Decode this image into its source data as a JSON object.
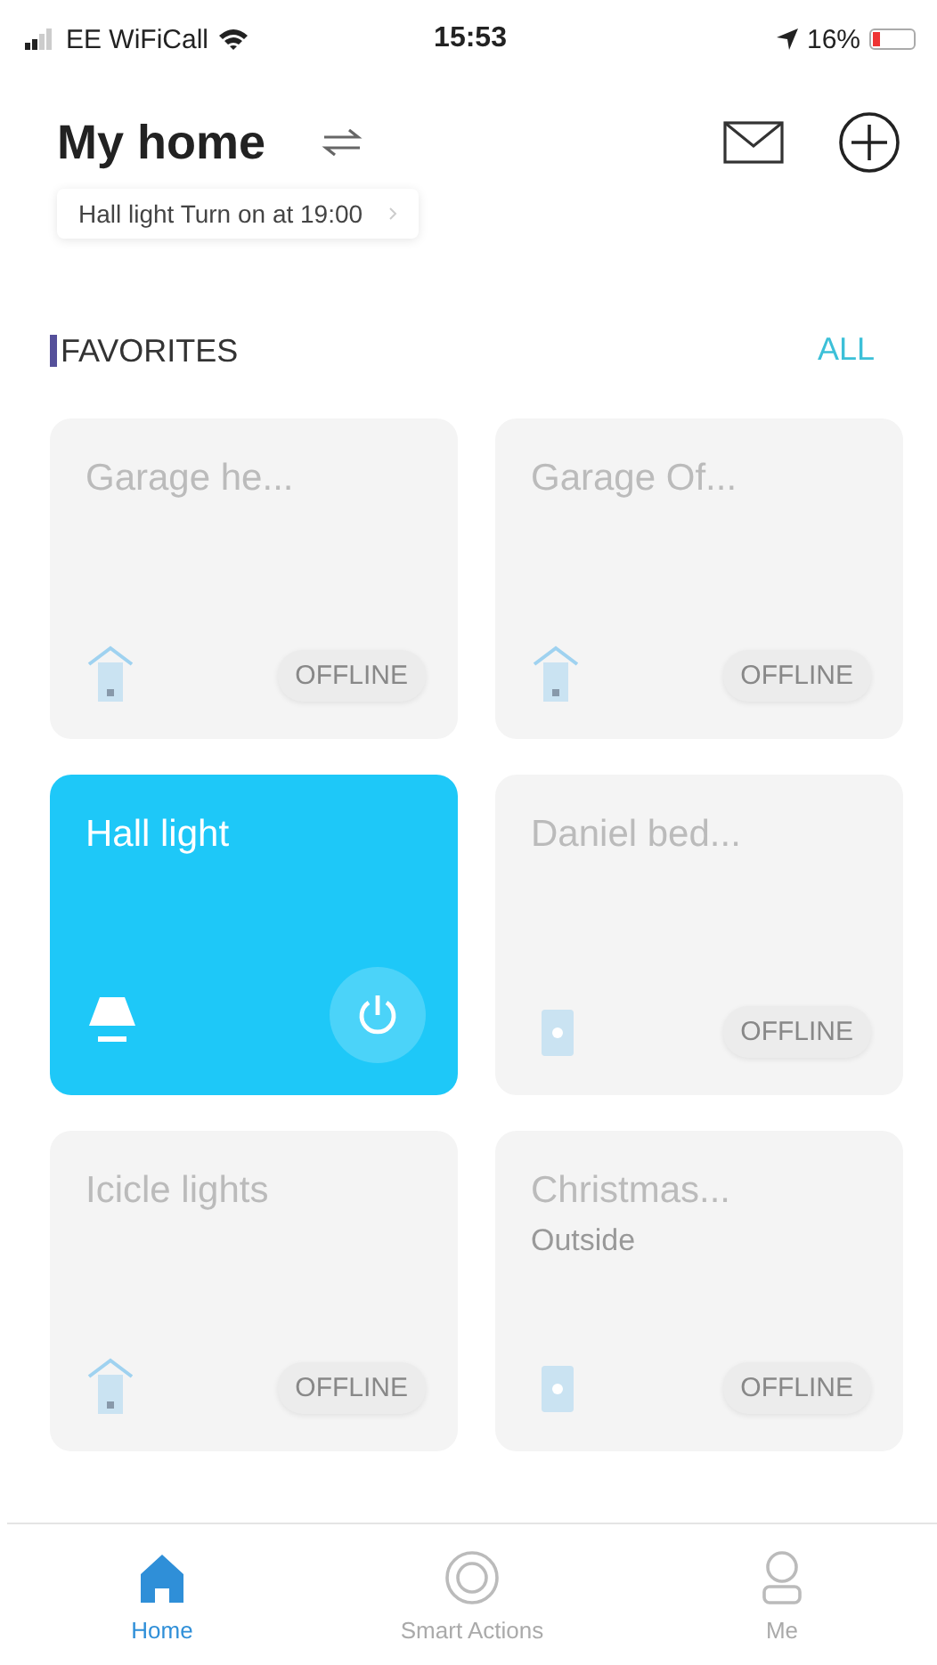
{
  "status_bar": {
    "carrier": "EE WiFiCall",
    "time": "15:53",
    "battery": "16%"
  },
  "header": {
    "title": "My home",
    "notice": "Hall light Turn on at 19:00"
  },
  "favorites": {
    "title": "FAVORITES",
    "link": "ALL"
  },
  "devices": [
    {
      "name": "Garage he...",
      "kind": "bulb",
      "online": false,
      "status": "OFFLINE"
    },
    {
      "name": "Garage Of...",
      "kind": "bulb",
      "online": false,
      "status": "OFFLINE"
    },
    {
      "name": "Hall light",
      "kind": "lamp",
      "online": true
    },
    {
      "name": "Daniel bed...",
      "kind": "plug",
      "online": false,
      "status": "OFFLINE"
    },
    {
      "name": "Icicle lights",
      "kind": "bulb",
      "online": false,
      "status": "OFFLINE"
    },
    {
      "name": "Christmas...",
      "subtitle": "Outside",
      "kind": "plug",
      "online": false,
      "status": "OFFLINE"
    }
  ],
  "tabs": [
    {
      "label": "Home",
      "selected": true
    },
    {
      "label": "Smart Actions",
      "selected": false
    },
    {
      "label": "Me",
      "selected": false
    }
  ]
}
